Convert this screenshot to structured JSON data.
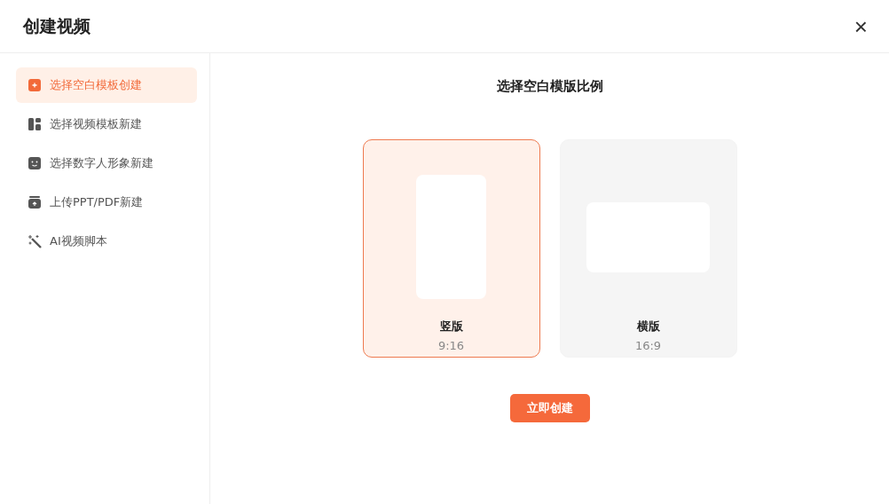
{
  "dialog": {
    "title": "创建视频",
    "close": "×"
  },
  "sidebar": {
    "items": [
      {
        "label": "选择空白模板创建",
        "selected": true
      },
      {
        "label": "选择视频模板新建",
        "selected": false
      },
      {
        "label": "选择数字人形象新建",
        "selected": false
      },
      {
        "label": "上传PPT/PDF新建",
        "selected": false
      },
      {
        "label": "AI视频脚本",
        "selected": false
      }
    ]
  },
  "main": {
    "title": "选择空白模版比例",
    "options": [
      {
        "kind": "portrait",
        "label": "竖版",
        "ratio": "9:16",
        "selected": true
      },
      {
        "kind": "landscape",
        "label": "横版",
        "ratio": "16:9",
        "selected": false
      }
    ],
    "create_button": "立即创建"
  }
}
